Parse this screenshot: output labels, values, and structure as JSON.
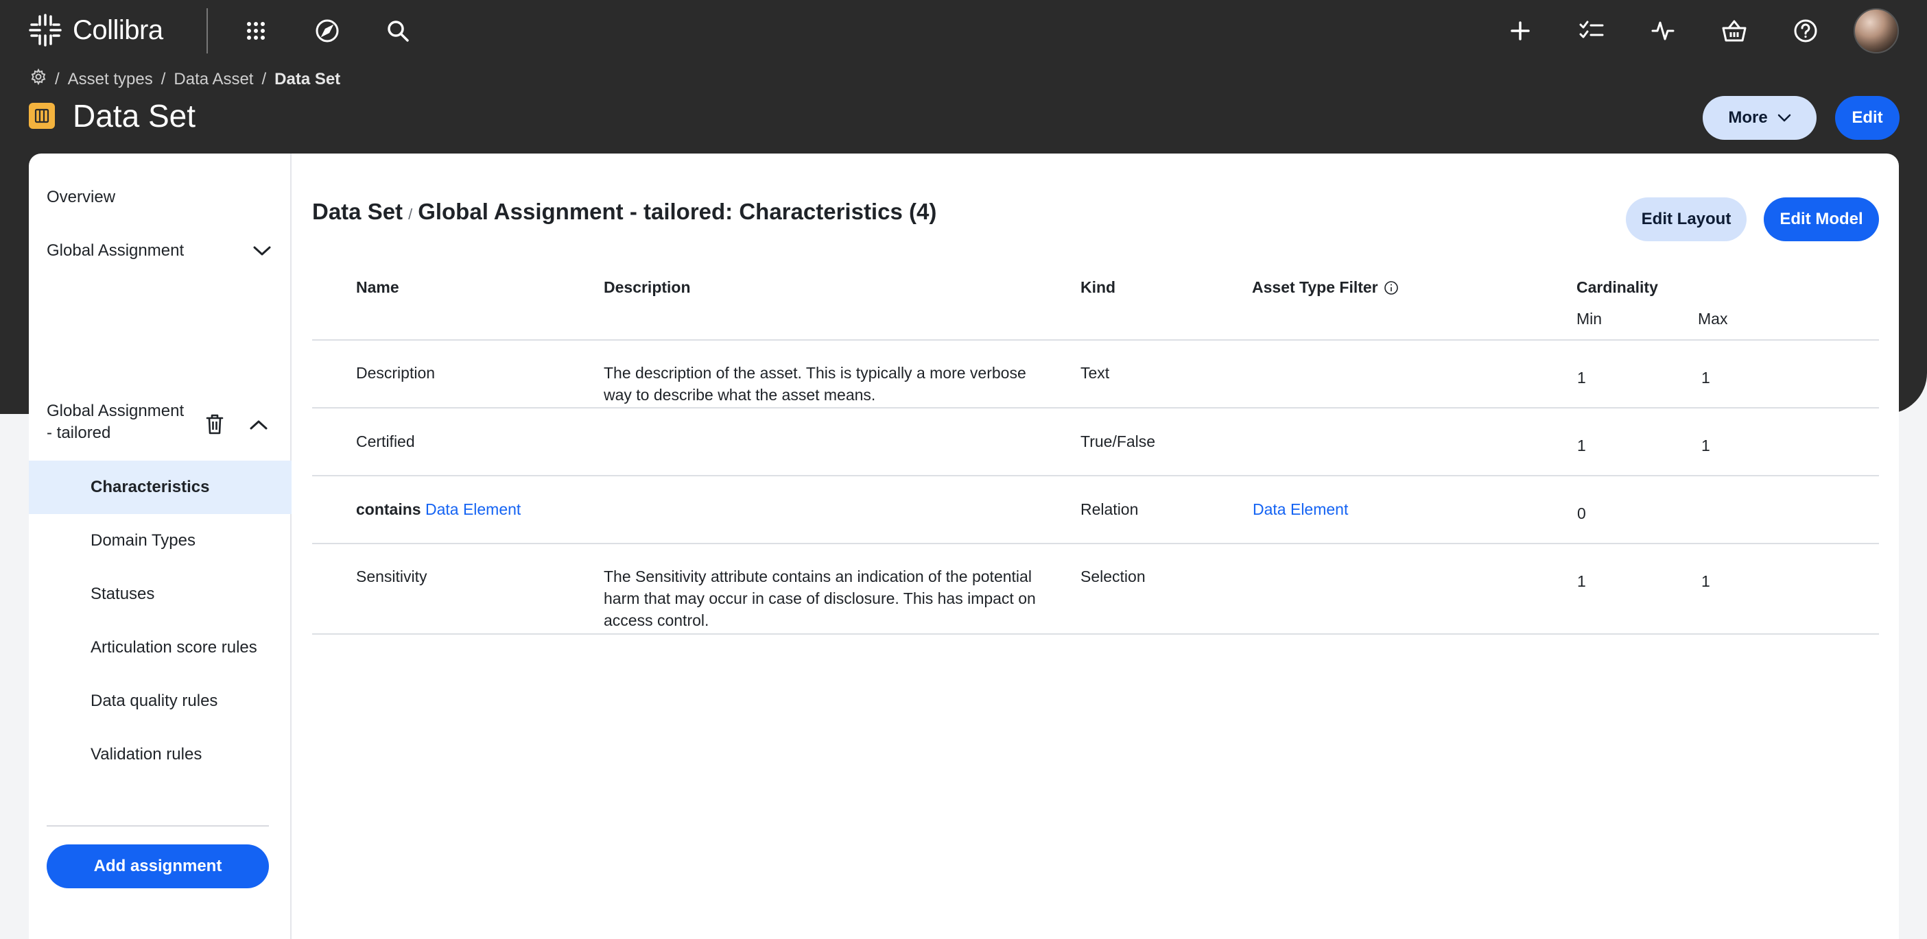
{
  "topbar": {
    "logo_text": "Collibra",
    "icons": [
      "apps-grid-icon",
      "compass-icon",
      "search-icon",
      "plus-icon",
      "tasks-icon",
      "activity-icon",
      "basket-icon",
      "help-icon"
    ]
  },
  "breadcrumb": {
    "items": [
      "Asset types",
      "Data Asset"
    ],
    "current": "Data Set"
  },
  "header": {
    "title": "Data Set",
    "more_label": "More",
    "edit_label": "Edit"
  },
  "sidebar": {
    "overview": "Overview",
    "global_assignment": "Global Assignment",
    "tailored_line1": "Global Assignment",
    "tailored_line2": "- tailored",
    "sub_items": [
      "Characteristics",
      "Domain Types",
      "Statuses",
      "Articulation score rules",
      "Data quality rules",
      "Validation rules"
    ],
    "add_label": "Add assignment"
  },
  "main": {
    "title_prefix": "Data Set",
    "title_sep": "/",
    "title_main": "Global Assignment - tailored: Characteristics (4)",
    "edit_layout_label": "Edit Layout",
    "edit_model_label": "Edit Model",
    "columns": {
      "name": "Name",
      "description": "Description",
      "kind": "Kind",
      "asset_type_filter": "Asset Type Filter",
      "cardinality": "Cardinality",
      "min": "Min",
      "max": "Max"
    },
    "rows": [
      {
        "name": "Description",
        "description_l1": "The description of the asset. This is typically a more verbose",
        "description_l2": "way to describe what the asset means.",
        "description_l3": "",
        "kind": "Text",
        "filter": "",
        "min": "1",
        "max": "1"
      },
      {
        "name": "Certified",
        "description_l1": "",
        "description_l2": "",
        "description_l3": "",
        "kind": "True/False",
        "filter": "",
        "min": "1",
        "max": "1"
      },
      {
        "name_bold": "contains",
        "name_link": "Data Element",
        "description_l1": "",
        "description_l2": "",
        "description_l3": "",
        "kind": "Relation",
        "filter": "Data Element",
        "min": "0",
        "max": ""
      },
      {
        "name": "Sensitivity",
        "description_l1": "The Sensitivity attribute contains an indication of the potential",
        "description_l2": "harm that may occur in case of disclosure. This has impact on",
        "description_l3": "access control.",
        "kind": "Selection",
        "filter": "",
        "min": "1",
        "max": "1"
      }
    ]
  },
  "colors": {
    "dark_header": "#2b2b2b",
    "primary": "#1463f3",
    "secondary": "#d3e2fb",
    "asset_icon": "#f4b33e",
    "active_item": "#e3eefd"
  }
}
